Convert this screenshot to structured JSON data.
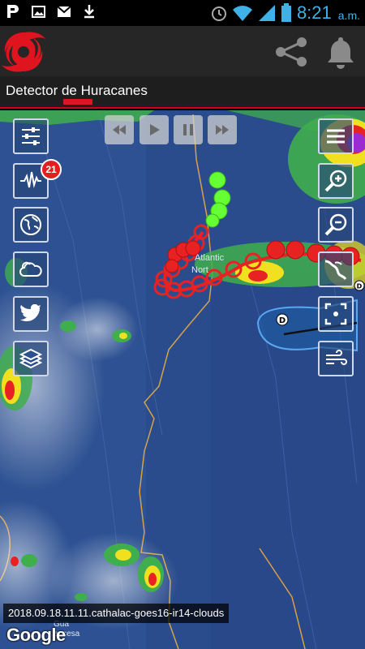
{
  "status_bar": {
    "left_icons": [
      "parking-icon",
      "image-icon",
      "gmail-icon",
      "download-icon"
    ],
    "right_icons": [
      "alarm-icon",
      "wifi-icon",
      "cell-signal-icon",
      "battery-icon"
    ],
    "time": "8:21",
    "ampm": "a.m."
  },
  "app_bar": {
    "logo_icon": "hurricane-logo-icon",
    "actions": [
      "share-icon",
      "bell-icon"
    ]
  },
  "tab": {
    "title": "Detector de Huracanes"
  },
  "map": {
    "playback_controls": [
      "rewind-icon",
      "play-icon",
      "pause-icon",
      "fast-forward-icon"
    ],
    "left_controls": [
      "settings-sliders-icon",
      "earthquake-wave-icon",
      "globe-icon",
      "weather-cloud-icon",
      "twitter-icon",
      "layers-icon"
    ],
    "earthquake_badge": "21",
    "right_controls": [
      "menu-icon",
      "zoom-in-icon",
      "zoom-out-icon",
      "map-region-icon",
      "locate-icon",
      "wind-icon"
    ],
    "storm_markers": [
      "D",
      "D"
    ],
    "place_labels": [
      "Atlantic",
      "Nort",
      "Gua",
      "ancesa"
    ],
    "caption": "2018.09.18.11.11.cathalac-goes16-ir14-clouds",
    "attribution": "Google"
  },
  "colors": {
    "accent_red": "#e0141e",
    "time_blue": "#3fb1e6",
    "ocean": "#2d4f8f",
    "track_red": "#e82222",
    "track_green": "#66ff33"
  }
}
